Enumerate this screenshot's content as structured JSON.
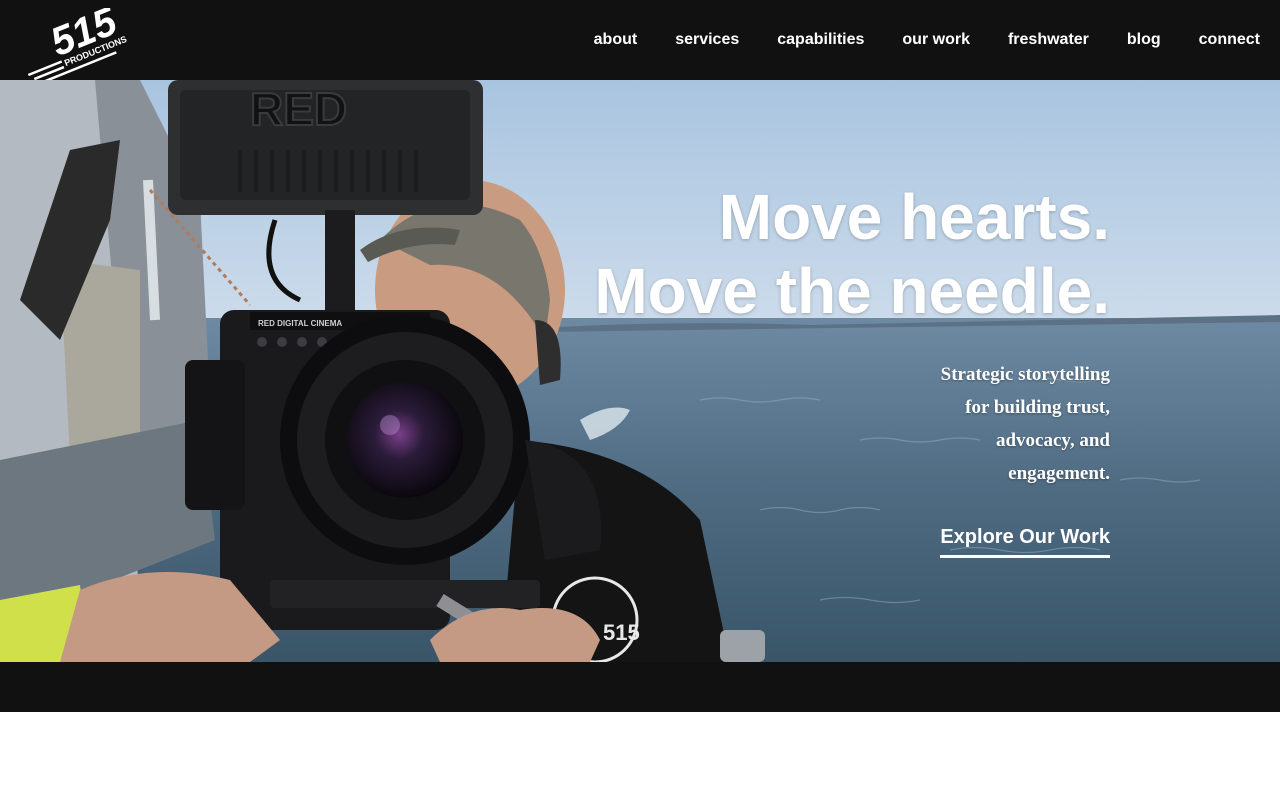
{
  "brand": {
    "logo_number": "515",
    "logo_word": "PRODUCTIONS"
  },
  "nav": {
    "items": [
      {
        "label": "about"
      },
      {
        "label": "services"
      },
      {
        "label": "capabilities"
      },
      {
        "label": "our work"
      },
      {
        "label": "freshwater"
      },
      {
        "label": "blog"
      },
      {
        "label": "connect"
      }
    ]
  },
  "hero": {
    "headline_line1": "Move hearts.",
    "headline_line2": "Move the needle.",
    "subhead_line1": "Strategic storytelling",
    "subhead_line2": "for building trust,",
    "subhead_line3": "advocacy, and",
    "subhead_line4": "engagement.",
    "cta_label": "Explore Our Work",
    "monitor_brand": "RED",
    "camera_label": "RED DIGITAL CINEMA",
    "shirt_logo": "515"
  },
  "colors": {
    "header_bg": "#111111",
    "text": "#ffffff",
    "sky": "#b9cfe6",
    "water": "#4d6a82"
  }
}
